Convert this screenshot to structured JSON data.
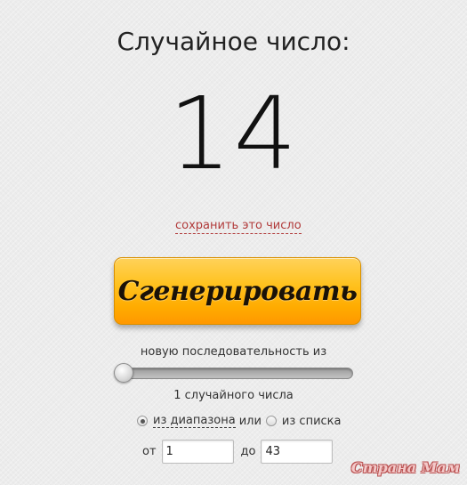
{
  "title": "Случайное число:",
  "result": "14",
  "save_link": "сохранить это число",
  "generate_button": "Сгенерировать",
  "sequence_label": "новую последовательность из",
  "count_slider": {
    "value": 1,
    "level": 0.0
  },
  "count_label": "1 случайного числа",
  "mode": {
    "range_label": "из диапазона",
    "or_label": "или",
    "list_label": "из списка",
    "selected": "range"
  },
  "range": {
    "from_label": "от",
    "from_value": "1",
    "to_label": "до",
    "to_value": "43"
  },
  "watermark": "Страна Мам"
}
